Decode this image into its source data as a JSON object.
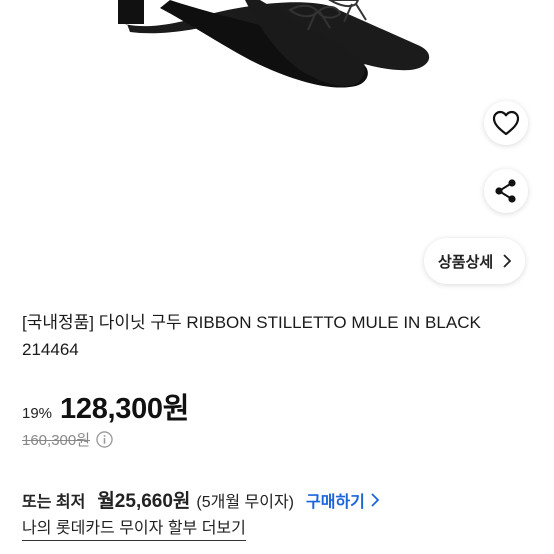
{
  "product": {
    "title": "[국내정품] 다이닛 구두 RIBBON STILLETTO MULE IN BLACK 214464",
    "discount": "19%",
    "price": "128,300원",
    "original_price": "160,300원"
  },
  "actions": {
    "detail_label": "상품상세"
  },
  "installment": {
    "prefix": "또는 최저",
    "monthly": "월25,660원",
    "terms": "(5개월 무이자)",
    "buy_label": "구매하기"
  },
  "card_link": "나의 롯데카드 무이자 할부 더보기",
  "icons": {
    "like": "heart-icon",
    "share": "share-icon",
    "detail": "chevron-right-icon",
    "info": "info-icon",
    "buy": "chevron-right-icon"
  },
  "colors": {
    "accent": "#1a66d9"
  }
}
